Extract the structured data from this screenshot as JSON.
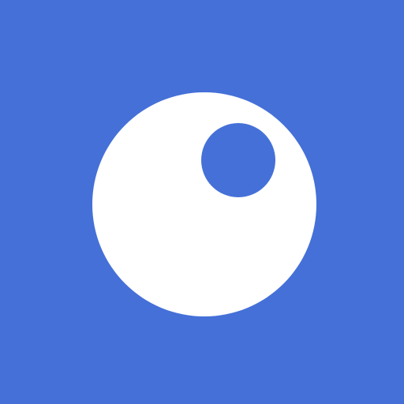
{
  "icon": {
    "name": "bubble-logo-icon",
    "colors": {
      "background": "#4570D8",
      "circle": "#FFFFFF",
      "cutout": "#4570D8"
    }
  }
}
